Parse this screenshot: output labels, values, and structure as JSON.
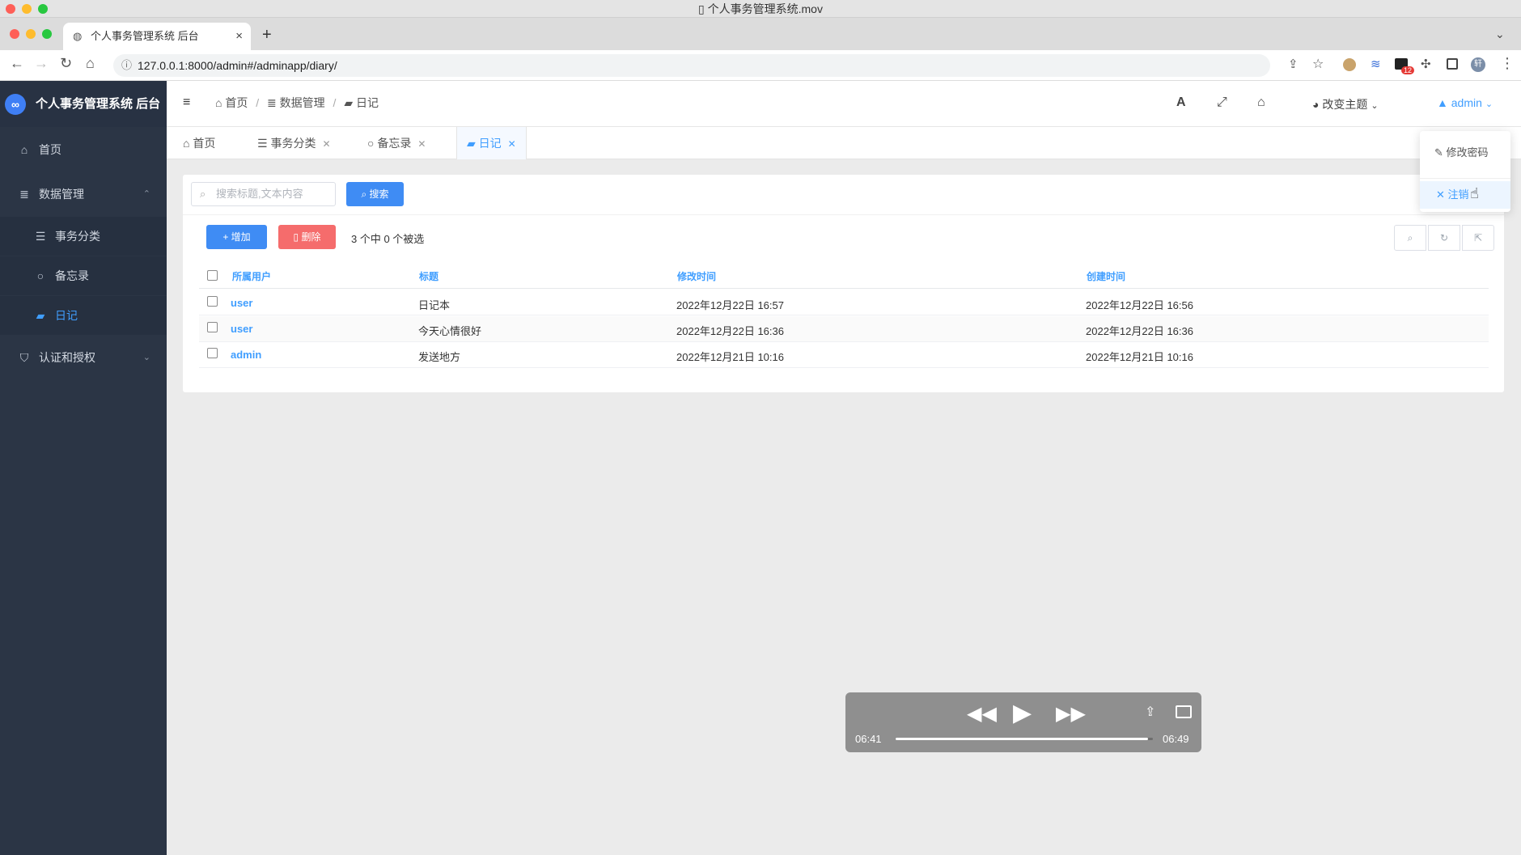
{
  "window": {
    "title": "个人事务管理系统.mov"
  },
  "browser": {
    "tab_title": "个人事务管理系统 后台",
    "tab_close": "×",
    "new_tab": "+",
    "url": "127.0.0.1:8000/admin#/adminapp/diary/",
    "ext_badge": "12",
    "profile": "轩"
  },
  "sidebar": {
    "logo": "个人事务管理系统 后台",
    "items": [
      {
        "label": "首页",
        "icon": "home-icon"
      },
      {
        "label": "数据管理",
        "icon": "database-icon"
      },
      {
        "label": "事务分类",
        "icon": "list-icon"
      },
      {
        "label": "备忘录",
        "icon": "circle-icon"
      },
      {
        "label": "日记",
        "icon": "book-icon"
      },
      {
        "label": "认证和授权",
        "icon": "shield-icon"
      }
    ]
  },
  "header": {
    "breadcrumb": [
      "首页",
      "数据管理",
      "日记"
    ],
    "separator": "/",
    "font_btn": "A",
    "theme_label": "改变主题",
    "user": "admin"
  },
  "page_tabs": [
    {
      "label": "首页"
    },
    {
      "label": "事务分类"
    },
    {
      "label": "备忘录"
    },
    {
      "label": "日记"
    }
  ],
  "dropdown": {
    "change_password": "修改密码",
    "logout": "注销"
  },
  "toolbar": {
    "search_placeholder": "搜索标题,文本内容",
    "search_btn": "搜索",
    "add_btn": "增加",
    "delete_btn": "删除",
    "selection": "3 个中 0 个被选"
  },
  "table": {
    "headers": [
      "所属用户",
      "标题",
      "修改时间",
      "创建时间"
    ],
    "rows": [
      {
        "user": "user",
        "title": "日记本",
        "modified": "2022年12月22日 16:57",
        "created": "2022年12月22日 16:56"
      },
      {
        "user": "user",
        "title": "今天心情很好",
        "modified": "2022年12月22日 16:36",
        "created": "2022年12月22日 16:36"
      },
      {
        "user": "admin",
        "title": "发送地方",
        "modified": "2022年12月21日 10:16",
        "created": "2022年12月21日 10:16"
      }
    ]
  },
  "video": {
    "elapsed": "06:41",
    "total": "06:49",
    "progress": 0.98
  },
  "colors": {
    "sidebar": "#2b3545",
    "accent": "#409eff",
    "danger": "#f56c6c",
    "primary_btn": "#3f8cf4"
  }
}
